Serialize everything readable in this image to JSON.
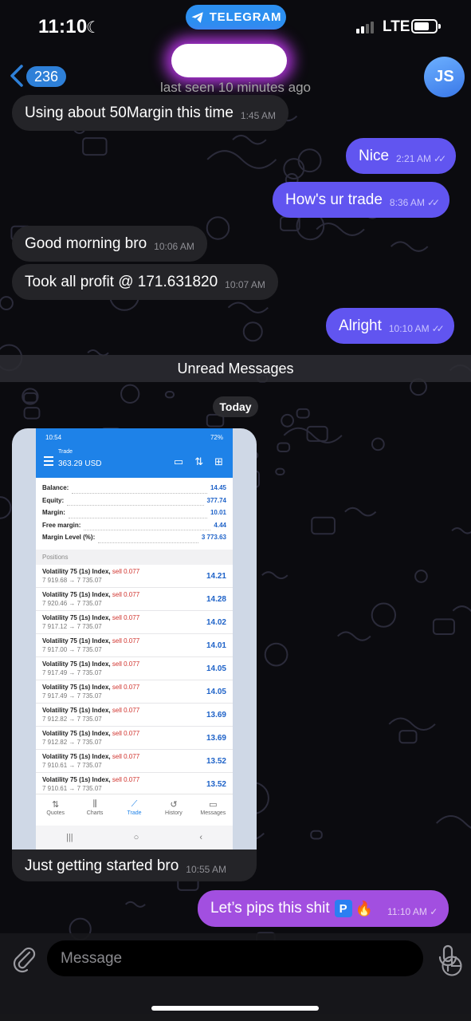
{
  "status_bar": {
    "time": "11:10",
    "app_pill": "TELEGRAM",
    "network": "LTE",
    "icons": [
      "moon-icon",
      "telegram-icon",
      "signal-icon",
      "battery-icon"
    ]
  },
  "header": {
    "back_count": "236",
    "contact_name": "",
    "last_seen": "last seen 10 minutes ago",
    "avatar_initials": "JS"
  },
  "messages": [
    {
      "dir": "in",
      "text": "Using about 50Margin this time",
      "time": "1:45 AM"
    },
    {
      "dir": "out",
      "text": "Nice",
      "time": "2:21 AM",
      "read": true
    },
    {
      "dir": "out",
      "text": "How's ur trade",
      "time": "8:36 AM",
      "read": true
    },
    {
      "dir": "in",
      "text": "Good morning bro",
      "time": "10:06 AM"
    },
    {
      "dir": "in",
      "text": "Took all profit @ 171.631820",
      "time": "10:07 AM"
    },
    {
      "dir": "out",
      "text": "Alright",
      "time": "10:10 AM",
      "read": true
    }
  ],
  "unread_label": "Unread Messages",
  "date_label": "Today",
  "photo_message": {
    "caption": "Just getting started bro",
    "time": "10:55 AM",
    "screenshot": {
      "status_time": "10:54",
      "status_battery": "72%",
      "title": "Trade",
      "balance_header": "363.29 USD",
      "stats": [
        {
          "label": "Balance:",
          "value": "14.45"
        },
        {
          "label": "Equity:",
          "value": "377.74"
        },
        {
          "label": "Margin:",
          "value": "10.01"
        },
        {
          "label": "Free margin:",
          "value": "4.44"
        },
        {
          "label": "Margin Level (%):",
          "value": "3 773.63"
        }
      ],
      "positions_label": "Positions",
      "positions": [
        {
          "symbol": "Volatility 75 (1s) Index,",
          "side": "sell 0.077",
          "prices": "7 919.68 → 7 735.07",
          "profit": "14.21"
        },
        {
          "symbol": "Volatility 75 (1s) Index,",
          "side": "sell 0.077",
          "prices": "7 920.46 → 7 735.07",
          "profit": "14.28"
        },
        {
          "symbol": "Volatility 75 (1s) Index,",
          "side": "sell 0.077",
          "prices": "7 917.12 → 7 735.07",
          "profit": "14.02"
        },
        {
          "symbol": "Volatility 75 (1s) Index,",
          "side": "sell 0.077",
          "prices": "7 917.00 → 7 735.07",
          "profit": "14.01"
        },
        {
          "symbol": "Volatility 75 (1s) Index,",
          "side": "sell 0.077",
          "prices": "7 917.49 → 7 735.07",
          "profit": "14.05"
        },
        {
          "symbol": "Volatility 75 (1s) Index,",
          "side": "sell 0.077",
          "prices": "7 917.49 → 7 735.07",
          "profit": "14.05"
        },
        {
          "symbol": "Volatility 75 (1s) Index,",
          "side": "sell 0.077",
          "prices": "7 912.82 → 7 735.07",
          "profit": "13.69"
        },
        {
          "symbol": "Volatility 75 (1s) Index,",
          "side": "sell 0.077",
          "prices": "7 912.82 → 7 735.07",
          "profit": "13.69"
        },
        {
          "symbol": "Volatility 75 (1s) Index,",
          "side": "sell 0.077",
          "prices": "7 910.61 → 7 735.07",
          "profit": "13.52"
        },
        {
          "symbol": "Volatility 75 (1s) Index,",
          "side": "sell 0.077",
          "prices": "7 910.61 → 7 735.07",
          "profit": "13.52"
        }
      ],
      "nav": [
        {
          "label": "Quotes",
          "icon": "⇅"
        },
        {
          "label": "Charts",
          "icon": "⫼"
        },
        {
          "label": "Trade",
          "icon": "⟋",
          "active": true
        },
        {
          "label": "History",
          "icon": "↺"
        },
        {
          "label": "Messages",
          "icon": "▭"
        }
      ],
      "system_nav": [
        "|||",
        "○",
        "‹"
      ]
    }
  },
  "last_message": {
    "text": "Let’s pips this shit",
    "emoji_p": "P",
    "emoji_fire": "🔥",
    "time": "11:10 AM",
    "read": true
  },
  "composer": {
    "placeholder": "Message"
  },
  "colors": {
    "outgoing": "#6155f0",
    "last_outgoing": "#a24fe0",
    "incoming": "#242428",
    "accent": "#2e80d8"
  }
}
